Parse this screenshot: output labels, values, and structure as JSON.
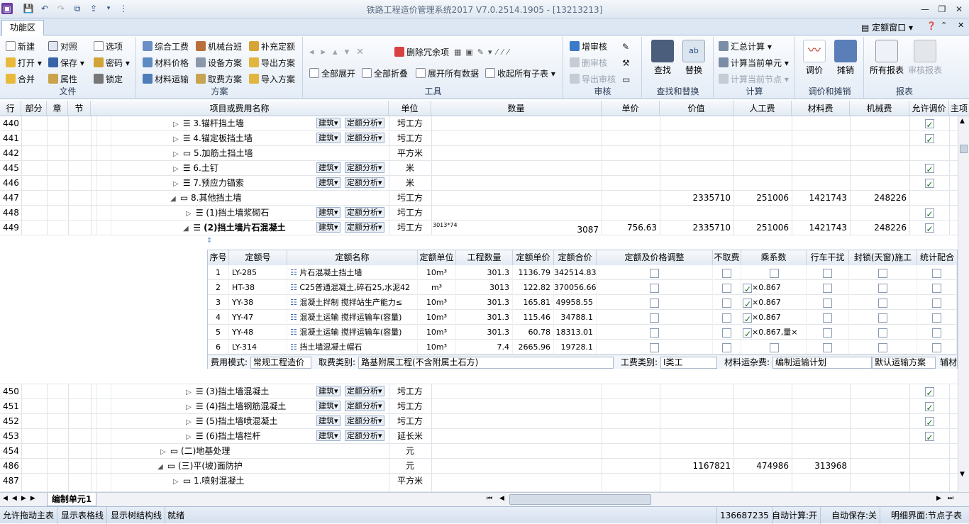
{
  "window": {
    "title": "铁路工程造价管理系统2017 V7.0.2514.1905 - [13213213]"
  },
  "tabs": {
    "function_area": "功能区",
    "dinge_window": "定额窗口"
  },
  "ribbon": {
    "file": {
      "label": "文件",
      "new": "新建",
      "open": "打开",
      "merge": "合并",
      "compare": "对照",
      "save": "保存",
      "props": "属性",
      "options": "选项",
      "password": "密码",
      "lock": "锁定"
    },
    "scheme": {
      "label": "方案",
      "comp_fee": "综合工费",
      "mach_shift": "机械台班",
      "supp_quota": "补充定额",
      "mat_price": "材料价格",
      "equip_scheme": "设备方案",
      "export_scheme": "导出方案",
      "mat_trans": "材料运输",
      "fee_scheme": "取费方案",
      "import_scheme": "导入方案"
    },
    "tools": {
      "label": "工具",
      "del_redundant": "删除冗余项",
      "expand_all": "全部展开",
      "collapse_all": "全部折叠",
      "expand_data": "展开所有数据",
      "collapse_sub": "收起所有子表"
    },
    "audit": {
      "label": "审核",
      "add": "增审核",
      "del": "删审核",
      "export": "导出审核"
    },
    "find": {
      "label": "查找和替换",
      "find": "查找",
      "replace": "替换"
    },
    "calc": {
      "label": "计算",
      "summary": "汇总计算",
      "calc_unit": "计算当前单元",
      "calc_node": "计算当前节点"
    },
    "adjust": {
      "label": "调价和摊销",
      "adjust": "调价",
      "amortize": "摊销"
    },
    "report": {
      "label": "报表",
      "all": "所有报表",
      "audit": "审核报表"
    }
  },
  "columns": {
    "row": "行",
    "part": "部分",
    "chapter": "章",
    "section": "节",
    "name": "项目或费用名称",
    "unit": "单位",
    "qty": "数量",
    "price": "单价",
    "value": "价值",
    "labor": "人工费",
    "material": "材料费",
    "machine": "机械费",
    "allow_adj": "允许调价",
    "main": "主项"
  },
  "tag_labels": {
    "jianzhu": "建筑",
    "dinge": "定额分析"
  },
  "rows": [
    {
      "no": "440",
      "name": "3.锚杆挡土墙",
      "unit": "圬工方",
      "check": true,
      "tags": true
    },
    {
      "no": "441",
      "name": "4.锚定板挡土墙",
      "unit": "圬工方",
      "check": true,
      "tags": true
    },
    {
      "no": "442",
      "name": "5.加筋土挡土墙",
      "unit": "平方米",
      "check": null,
      "tags": false
    },
    {
      "no": "445",
      "name": "6.土钉",
      "unit": "米",
      "check": true,
      "tags": true
    },
    {
      "no": "446",
      "name": "7.预应力锚索",
      "unit": "米",
      "check": true,
      "tags": true
    },
    {
      "no": "447",
      "name": "8.其他挡土墙",
      "unit": "圬工方",
      "value": "2335710",
      "labor": "251006",
      "material": "1421743",
      "machine": "248226",
      "check": null,
      "tags": false
    },
    {
      "no": "448",
      "name": "(1)挡土墙浆砌石",
      "unit": "圬工方",
      "check": true,
      "tags": true
    },
    {
      "no": "449",
      "name": "(2)挡土墙片石混凝土",
      "unit": "圬工方",
      "qty_formula": "3013*74",
      "qty": "3087",
      "price": "756.63",
      "value": "2335710",
      "labor": "251006",
      "material": "1421743",
      "machine": "248226",
      "check": true,
      "tags": true
    },
    {
      "no": "450",
      "name": "(3)挡土墙混凝土",
      "unit": "圬工方",
      "check": true,
      "tags": true
    },
    {
      "no": "451",
      "name": "(4)挡土墙钢筋混凝土",
      "unit": "圬工方",
      "check": true,
      "tags": true
    },
    {
      "no": "452",
      "name": "(5)挡土墙喷混凝土",
      "unit": "圬工方",
      "check": true,
      "tags": true
    },
    {
      "no": "453",
      "name": "(6)挡土墙栏杆",
      "unit": "延长米",
      "check": true,
      "tags": true
    },
    {
      "no": "454",
      "name": "(二)地基处理",
      "unit": "元",
      "check": null,
      "tags": false
    },
    {
      "no": "486",
      "name": "(三)平(坡)面防护",
      "unit": "元",
      "value": "1167821",
      "labor": "474986",
      "material": "313968",
      "check": null,
      "tags": false
    },
    {
      "no": "487",
      "name": "1.喷射混凝土",
      "unit": "平方米",
      "check": null,
      "tags": false
    }
  ],
  "sub": {
    "columns": {
      "seq": "序号",
      "code": "定额号",
      "name": "定额名称",
      "unit": "定额单位",
      "qty": "工程数量",
      "price": "定额单价",
      "total": "定额合价",
      "adjust": "定额及价格调整",
      "nofee": "不取费",
      "coef": "乘系数",
      "traffic": "行车干扰",
      "lock": "封锁(天窗)施工",
      "stat": "统计配合"
    },
    "rows": [
      {
        "seq": "1",
        "code": "LY-285",
        "name": "片石混凝土挡土墙",
        "unit": "10m³",
        "qty": "301.3",
        "price": "1136.79",
        "total": "342514.83",
        "coef_on": false,
        "coef": ""
      },
      {
        "seq": "2",
        "code": "HT-38",
        "name": "C25普通混凝土,碎石25,水泥42",
        "unit": "m³",
        "qty": "3013",
        "price": "122.82",
        "total": "370056.66",
        "coef_on": true,
        "coef": "×0.867"
      },
      {
        "seq": "3",
        "code": "YY-38",
        "name": "混凝土拌制 搅拌站生产能力≤",
        "unit": "10m³",
        "qty": "301.3",
        "price": "165.81",
        "total": "49958.55",
        "coef_on": true,
        "coef": "×0.867"
      },
      {
        "seq": "4",
        "code": "YY-47",
        "name": "混凝土运输 搅拌运输车(容量)",
        "unit": "10m³",
        "qty": "301.3",
        "price": "115.46",
        "total": "34788.1",
        "coef_on": true,
        "coef": "×0.867"
      },
      {
        "seq": "5",
        "code": "YY-48",
        "name": "混凝土运输 搅拌运输车(容量)",
        "unit": "10m³",
        "qty": "301.3",
        "price": "60.78",
        "total": "18313.01",
        "coef_on": true,
        "coef": "×0.867,量×"
      },
      {
        "seq": "6",
        "code": "LY-314",
        "name": "挡土墙混凝土帽石",
        "unit": "10m³",
        "qty": "7.4",
        "price": "2665.96",
        "total": "19728.1",
        "coef_on": false,
        "coef": ""
      }
    ],
    "footer": {
      "fee_mode_lbl": "费用模式:",
      "fee_mode": "常规工程造价",
      "fee_type_lbl": "取费类别:",
      "fee_type": "路基附属工程(不含附属土石方)",
      "labor_type_lbl": "工费类别:",
      "labor_type": "I类工",
      "mat_fee_lbl": "材料运杂费:",
      "mat_fee": "编制运输计划",
      "default_scheme": "默认运输方案",
      "aux": "辅材"
    }
  },
  "sheet_tab": "编制单元1",
  "status": {
    "drag_main": "允许拖动主表",
    "show_grid": "显示表格线",
    "show_tree": "显示树结构线",
    "ready": "就绪",
    "total": "136687235",
    "auto_calc": "自动计算:开",
    "auto_save": "自动保存:关",
    "detail": "明细界面:节点子表"
  },
  "colors": {
    "ribbon_bg": "#e4ecf6",
    "accent": "#2c4f86",
    "check_green": "#1a6b1a"
  }
}
